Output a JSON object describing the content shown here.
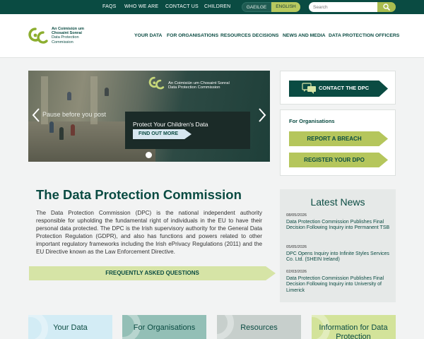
{
  "topbar": {
    "links": [
      "FAQS",
      "WHO WE ARE",
      "CONTACT US",
      "CHILDREN"
    ],
    "lang_ga": "GAEILGE",
    "lang_en": "ENGLISH",
    "search_placeholder": "Search"
  },
  "logo": {
    "line1": "An Coimisiún um",
    "line2": "Chosaint Sonraí",
    "line3": "Data Protection",
    "line4": "Commission"
  },
  "nav": [
    "YOUR DATA",
    "FOR ORGANISATIONS",
    "RESOURCES",
    "DECISIONS",
    "NEWS AND MEDIA",
    "DATA PROTECTION OFFICERS"
  ],
  "hero": {
    "pause": "Pause before you post",
    "logo_line1": "An Coimisiún um Chosaint Sonraí",
    "logo_line2": "Data Protection Commission",
    "box_title": "Protect Your Children's Data",
    "cta": "FIND OUT MORE"
  },
  "contact": {
    "label": "CONTACT THE DPC"
  },
  "organisations": {
    "title": "For Organisations",
    "breach": "REPORT A BREACH",
    "register": "REGISTER YOUR DPO"
  },
  "main": {
    "title": "The Data Protection Commission",
    "paragraph": "The Data Protection Commission (DPC) is the national independent authority responsible for upholding the fundamental right of individuals in the EU to have their personal data protected. The DPC is the Irish supervisory authority for the General Data Protection Regulation (GDPR), and also has functions and powers related to other important regulatory frameworks including the Irish ePrivacy Regulations (2011) and the EU Directive known as the Law Enforcement Directive.",
    "faq": "FREQUENTLY ASKED QUESTIONS"
  },
  "news": {
    "title": "Latest News",
    "items": [
      {
        "date": "08/05/2026",
        "text": "Data Protection Commission Publishes Final Decision Following Inquiry into Permanent TSB"
      },
      {
        "date": "05/05/2026",
        "text": "DPC Opens Inquiry into Infinite Styles Services Co. Ltd. (SHEIN Ireland)"
      },
      {
        "date": "02/03/2026",
        "text": "Data Protection Commission Publishes Final Decision Following Inquiry into University of Limerick"
      }
    ]
  },
  "tiles": [
    "Your Data",
    "For Organisations",
    "Resources",
    "Information for Data Protection"
  ],
  "colors": {
    "brand_dark": "#0a4b42",
    "brand_green": "#b5c65c",
    "tile_blue": "#d3ecf5",
    "tile_teal": "#93bfb6",
    "tile_grey": "#c7cfcc",
    "tile_lime": "#d3e39a"
  }
}
